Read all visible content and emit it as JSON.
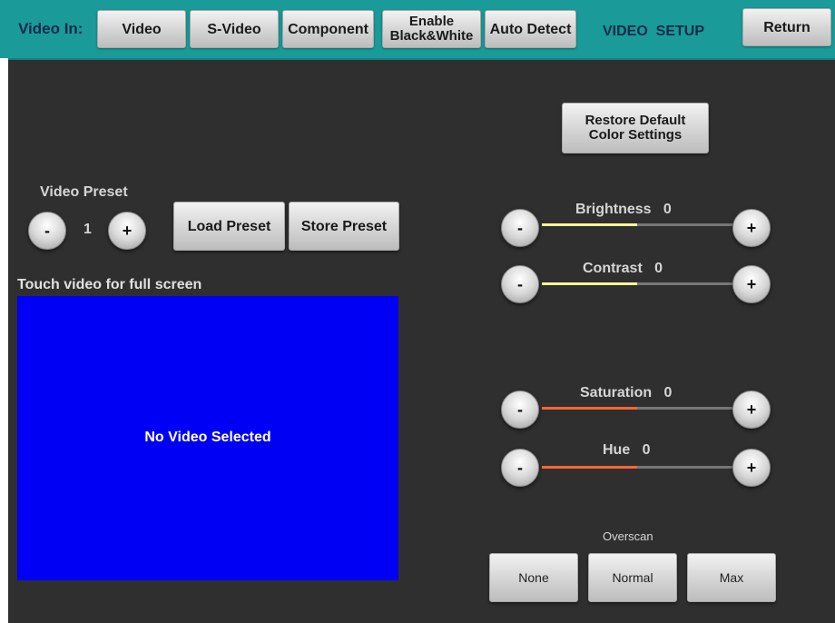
{
  "header": {
    "video_in_label": "Video In:",
    "inputs": [
      "Video",
      "S-Video",
      "Component"
    ],
    "enable_bw_line1": "Enable",
    "enable_bw_line2": "Black&White",
    "auto_detect": "Auto Detect",
    "page_title": "VIDEO  SETUP",
    "return_label": "Return"
  },
  "restore": {
    "line1": "Restore Default",
    "line2": "Color Settings"
  },
  "preset": {
    "title": "Video Preset",
    "minus": "-",
    "value": "1",
    "plus": "+",
    "load_label": "Load Preset",
    "store_label": "Store Preset"
  },
  "video": {
    "hint": "Touch video for full screen",
    "status": "No Video Selected",
    "background": "#0000f4"
  },
  "sliders": [
    {
      "name": "Brightness",
      "value": "0",
      "level": 0.5,
      "color": "#ffff99",
      "minus": "-",
      "plus": "+"
    },
    {
      "name": "Contrast",
      "value": "0",
      "level": 0.5,
      "color": "#ffff99",
      "minus": "-",
      "plus": "+"
    },
    {
      "name": "Saturation",
      "value": "0",
      "level": 0.5,
      "color": "#ff6633",
      "minus": "-",
      "plus": "+"
    },
    {
      "name": "Hue",
      "value": "0",
      "level": 0.5,
      "color": "#ff6633",
      "minus": "-",
      "plus": "+"
    }
  ],
  "overscan": {
    "title": "Overscan",
    "options": [
      "None",
      "Normal",
      "Max"
    ]
  },
  "colors": {
    "topbar": "#1a9a99",
    "background": "#2f2f2f",
    "accent_yellow": "#ffff99",
    "accent_orange": "#ff6633"
  }
}
